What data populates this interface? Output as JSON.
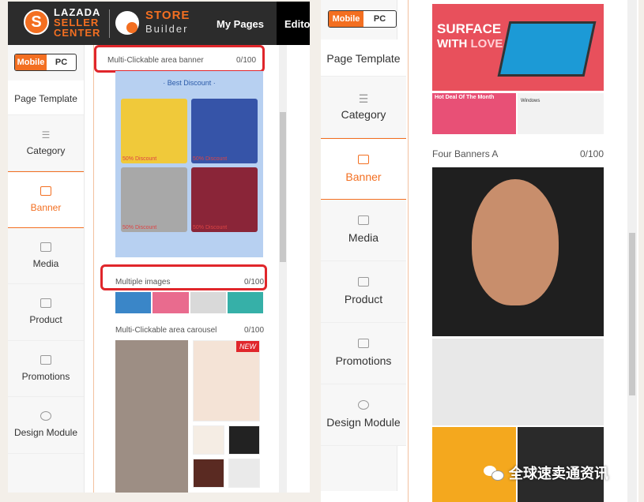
{
  "left_panel": {
    "header": {
      "brand_line1": "LAZADA",
      "brand_line2": "SELLER",
      "brand_line3": "CENTER",
      "logo_letter": "S",
      "product_title": "STORE",
      "product_subtitle": "Builder",
      "nav_my_pages": "My Pages",
      "nav_editor": "Editor",
      "accent_color": "#f36f21"
    },
    "toggle": {
      "mobile": "Mobile",
      "pc": "PC",
      "selected": "Mobile"
    },
    "sidebar": [
      {
        "label": "Page Template",
        "icon": "none"
      },
      {
        "label": "Category",
        "icon": "list-icon"
      },
      {
        "label": "Banner",
        "icon": "image-icon",
        "active": true
      },
      {
        "label": "Media",
        "icon": "video-icon"
      },
      {
        "label": "Product",
        "icon": "box-icon"
      },
      {
        "label": "Promotions",
        "icon": "promo-icon"
      },
      {
        "label": "Design Module",
        "icon": "design-icon"
      }
    ],
    "modules": [
      {
        "title": "Multi-Clickable area banner",
        "count": "0/100",
        "highlighted": true
      },
      {
        "title": "Multiple images",
        "count": "0/100",
        "highlighted": true
      },
      {
        "title": "Multi-Clickable area carousel",
        "count": "0/100",
        "highlighted": false
      }
    ],
    "banner_preview": {
      "header": "· Best Discount ·",
      "tiles": [
        "50% Discount",
        "50% Discount",
        "50% Discount",
        "50% Discount"
      ]
    },
    "carousel_badge": "NEW"
  },
  "right_panel": {
    "toggle": {
      "mobile": "Mobile",
      "pc": "PC",
      "selected": "Mobile"
    },
    "sidebar": [
      {
        "label": "Page Template",
        "icon": "none"
      },
      {
        "label": "Category",
        "icon": "list-icon"
      },
      {
        "label": "Banner",
        "icon": "image-icon",
        "active": true
      },
      {
        "label": "Media",
        "icon": "video-icon"
      },
      {
        "label": "Product",
        "icon": "box-icon"
      },
      {
        "label": "Promotions",
        "icon": "promo-icon"
      },
      {
        "label": "Design Module",
        "icon": "design-icon"
      }
    ],
    "surface_banner": {
      "line1": "SURFACE",
      "line2_a": "WITH ",
      "line2_b": "LOVE"
    },
    "hot_deal": "Hot Deal Of The Month",
    "windows_tile": "Windows",
    "module": {
      "title": "Four Banners A",
      "count": "0/100"
    }
  },
  "watermark": "全球速卖通资讯"
}
